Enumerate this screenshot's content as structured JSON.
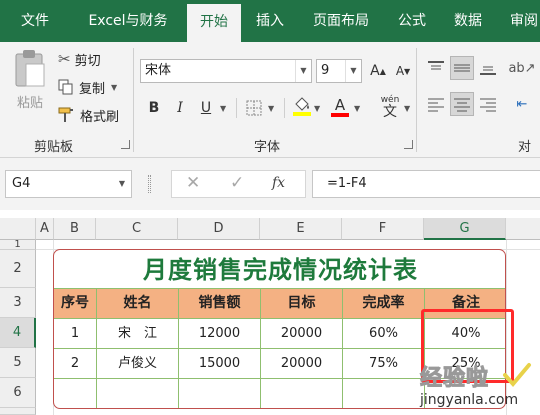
{
  "ribbon_tabs": [
    "文件",
    "Excel与财务",
    "开始",
    "插入",
    "页面布局",
    "公式",
    "数据",
    "审阅"
  ],
  "active_tab": "开始",
  "clipboard": {
    "paste_label": "粘贴",
    "cut_label": "剪切",
    "copy_label": "复制",
    "format_painter_label": "格式刷",
    "group_label": "剪贴板"
  },
  "font": {
    "name": "宋体",
    "size": "9",
    "group_label": "字体",
    "bold": "B",
    "italic": "I",
    "underline": "U",
    "grow": "A",
    "shrink": "A",
    "font_color_glyph": "A",
    "phonetic": "wén"
  },
  "alignment": {
    "group_label": "对齐"
  },
  "formula_bar": {
    "name_box": "G4",
    "fx": "fx",
    "formula": "=1-F4"
  },
  "columns": [
    "A",
    "B",
    "C",
    "D",
    "E",
    "F",
    "G"
  ],
  "rows": [
    "1",
    "2",
    "3",
    "4",
    "5",
    "6"
  ],
  "table": {
    "title": "月度销售完成情况统计表",
    "headers": [
      "序号",
      "姓名",
      "销售额",
      "目标",
      "完成率",
      "备注"
    ],
    "rows": [
      [
        "1",
        "宋　江",
        "12000",
        "20000",
        "60%",
        "40%"
      ],
      [
        "2",
        "卢俊义",
        "15000",
        "20000",
        "75%",
        "25%"
      ]
    ]
  },
  "watermark": {
    "line1": "经验啦",
    "line2": "jingyanla.com"
  },
  "colors": {
    "ribbon_green": "#217346",
    "title_green": "#1e7a3c",
    "header_fill": "#f4b183",
    "highlight_red": "#ff2a2a"
  }
}
